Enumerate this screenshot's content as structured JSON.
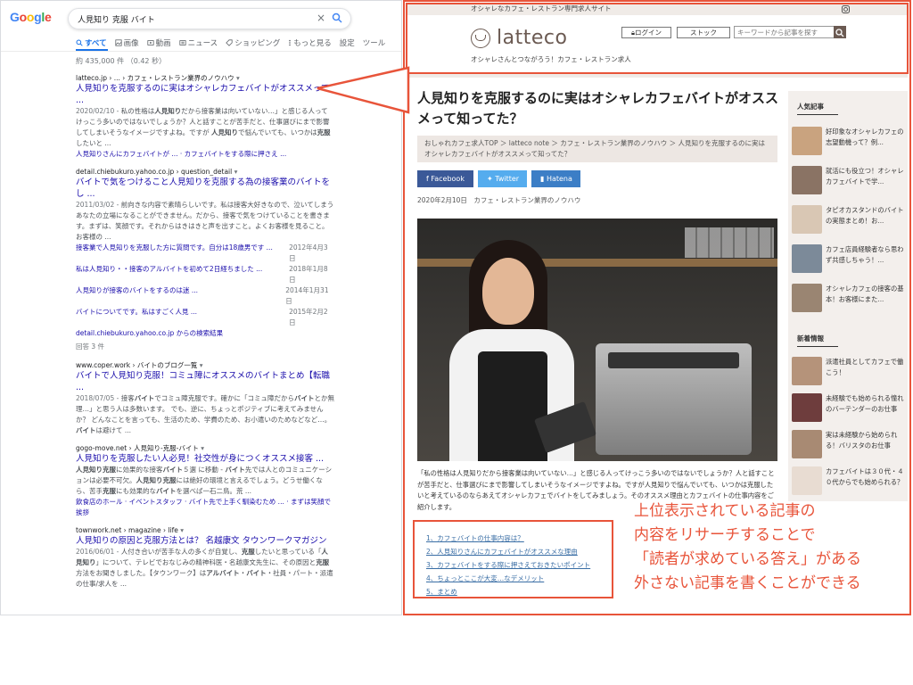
{
  "colors": {
    "accent": "#e8543a",
    "google_link": "#1a0dab",
    "google_blue": "#1a73e8",
    "latteco_brown": "#6b5a52"
  },
  "google": {
    "logo": "Google",
    "logo_letters": [
      {
        "ch": "G",
        "color": "#4285f4"
      },
      {
        "ch": "o",
        "color": "#ea4335"
      },
      {
        "ch": "o",
        "color": "#fbbc05"
      },
      {
        "ch": "g",
        "color": "#4285f4"
      },
      {
        "ch": "l",
        "color": "#34a853"
      },
      {
        "ch": "e",
        "color": "#ea4335"
      }
    ],
    "query": "人見知り 克服 バイト",
    "clear_icon": "×",
    "tabs": [
      "すべて",
      "画像",
      "動画",
      "ニュース",
      "ショッピング",
      "もっと見る",
      "設定",
      "ツール"
    ],
    "stats": "約 435,000 件 （0.42 秒）",
    "results": [
      {
        "cite": "latteco.jp › ... › カフェ・レストラン業界のノウハウ",
        "title": "人見知りを克服するのに実はオシャレカフェバイトがオススメって ...",
        "snippet": [
          {
            "t": "2020/02/10 - ",
            "c": "date"
          },
          {
            "t": "私の性格は"
          },
          {
            "t": "人見知り",
            "c": "b"
          },
          {
            "t": "だから接客業は向いていない…」と感じる人ってけっこう多いのではないでしょうか？人と話すことが苦手だと、仕事選びにまで影響してしまいそうなイメージですよね。ですが "
          },
          {
            "t": "人見知り",
            "c": "b"
          },
          {
            "t": "で悩んでいても、いつかは"
          },
          {
            "t": "克服",
            "c": "b"
          },
          {
            "t": "したいと ..."
          }
        ],
        "sitelinks": "人見知りさんにカフェバイトが ... · カフェバイトをする際に押さえ ..."
      },
      {
        "cite": "detail.chiebukuro.yahoo.co.jp › question_detail",
        "title": "バイトで気をつけること人見知りを克服する為の接客業のバイトをし ...",
        "snippet": [
          {
            "t": "2011/03/02 - ",
            "c": "date"
          },
          {
            "t": "前向きな内容で素晴らしいです。私は接客大好きなので、泣いてしまうあなたの立場になることができません。だから、接客で気をつけていることを書きます。まずは、笑顔です。それからはきはきと声を出すこと。よくお客様を見ること。お客様の ..."
          }
        ],
        "qa": [
          {
            "q": "接客業で人見知りを克服した方に質問です。自分は18歳男です ...",
            "d": "2012年4月3日"
          },
          {
            "q": "私は人見知り・・接客のアルバイトを初めて2日経ちました ...",
            "d": "2018年1月8日"
          },
          {
            "q": "人見知りが接客のバイトをするのは迷 ...",
            "d": "2014年1月31日"
          },
          {
            "q": "バイトについてです。私はすごく人見 ...",
            "d": "2015年2月2日"
          }
        ],
        "more": "detail.chiebukuro.yahoo.co.jp からの検索結果",
        "answers": "回答 3 件"
      },
      {
        "cite": "www.coper.work › バイトのブログ一覧",
        "title": "バイトで人見知り克服！コミュ障にオススメのバイトまとめ【転職 ...",
        "snippet": [
          {
            "t": "2018/07/05 - ",
            "c": "date"
          },
          {
            "t": "接客"
          },
          {
            "t": "バイト",
            "c": "b"
          },
          {
            "t": "でコミュ障克服です。確かに「コミュ障だから"
          },
          {
            "t": "バイト",
            "c": "b"
          },
          {
            "t": "とか無理…」と思う人は多数います。 でも、逆に、ちょっとポジティブに考えてみませんか？ どんなことを言っても、生活のため、学費のため、お小遣いのためなどなど…。"
          },
          {
            "t": "バイト",
            "c": "b"
          },
          {
            "t": "は避けて ..."
          }
        ]
      },
      {
        "cite": "gogo-move.net › 人見知り-克服-バイト",
        "title": "人見知りを克服したい人必見！社交性が身につくオススメ接客 ...",
        "snippet": [
          {
            "t": "人見知り",
            "c": "b"
          },
          {
            "t": "克服",
            "c": "b"
          },
          {
            "t": "に効果的な接客"
          },
          {
            "t": "バイト",
            "c": "b"
          },
          {
            "t": "５選 に移動 - "
          },
          {
            "t": "バイト",
            "c": "b"
          },
          {
            "t": "先では人とのコミュニケーションは必要不可欠。"
          },
          {
            "t": "人見知り",
            "c": "b"
          },
          {
            "t": "克服",
            "c": "b"
          },
          {
            "t": "には絶好の環境と言えるでしょう。どうせ働くなら、苦手"
          },
          {
            "t": "克服",
            "c": "b"
          },
          {
            "t": "にも効果的な"
          },
          {
            "t": "バイト",
            "c": "b"
          },
          {
            "t": "を選べば一石二鳥。荒 ..."
          }
        ],
        "sitelinks": "飲食店のホール · イベントスタッフ · バイト先で上手く馴染むため ... · まずは笑顔で挨拶"
      },
      {
        "cite": "townwork.net › magazine › life",
        "title": "人見知りの原因と克服方法とは？ 名越康文 タウンワークマガジン",
        "snippet": [
          {
            "t": "2016/06/01 - ",
            "c": "date"
          },
          {
            "t": "人付き合いが苦手な人の多くが自覚し、"
          },
          {
            "t": "克服",
            "c": "b"
          },
          {
            "t": "したいと思っている「"
          },
          {
            "t": "人見知り",
            "c": "b"
          },
          {
            "t": "」について、テレビでおなじみの精神科医・名越康文先生に、その原因と"
          },
          {
            "t": "克服",
            "c": "b"
          },
          {
            "t": "方法をお聞きしました。【タウンワーク】は"
          },
          {
            "t": "アルバイト",
            "c": "b"
          },
          {
            "t": "・"
          },
          {
            "t": "バイト",
            "c": "b"
          },
          {
            "t": "・社員・パート・派遣の仕事/求人を ..."
          }
        ]
      }
    ]
  },
  "latteco": {
    "topbar_text": "オシャレなカフェ・レストラン専門求人サイト",
    "logo_text": "latteco",
    "tagline": "オシャレさんとつながろう！カフェ・レストラン求人",
    "login_label": "ログイン",
    "stock_label": "ストック",
    "search_placeholder": "キーワードから記事を探す",
    "article_title": "人見知りを克服するのに実はオシャレカフェバイトがオススメって知ってた？",
    "breadcrumb": "おしゃれカフェ求人TOP ＞ latteco note ＞ カフェ・レストラン業界のノウハウ ＞ 人見知りを克服するのに実はオシャレカフェバイトがオススメって知ってた？",
    "share": {
      "facebook": "Facebook",
      "twitter": "Twitter",
      "hatena": "Hatena"
    },
    "date": "2020年2月10日　カフェ・レストラン業界のノウハウ",
    "body_text": "「私の性格は人見知りだから接客業は向いていない…」と感じる人ってけっこう多いのではないでしょうか？人と話すことが苦手だと、仕事選びにまで影響してしまいそうなイメージですよね。ですが人見知りで悩んでいても、いつかは克服したいと考えているのならあえてオシャレカフェでバイトをしてみましょう。そのオススメ理由とカフェバイトの仕事内容をご紹介します。",
    "toc": [
      "1、カフェバイトの仕事内容は？",
      "2、人見知りさんにカフェバイトがオススメな理由",
      "3、カフェバイトをする際に押さえておきたいポイント",
      "4、ちょっとここが大変…なデメリット",
      "5、まとめ"
    ],
    "sidebar": {
      "popular_heading": "人気記事",
      "popular": [
        {
          "text": "好印象なオシャレカフェの志望動機って？例...",
          "color": "#c9a37f"
        },
        {
          "text": "就活にも役立つ！オシャレカフェバイトで学...",
          "color": "#8a7364"
        },
        {
          "text": "タピオカスタンドのバイトの実態まとめ！お...",
          "color": "#d9c7b4"
        },
        {
          "text": "カフェ店員経験者なら思わず共感しちゃう！...",
          "color": "#7c8a99"
        },
        {
          "text": "オシャレカフェの接客の基本！お客様にまた...",
          "color": "#9a8572"
        }
      ],
      "new_heading": "新着情報",
      "new": [
        {
          "text": "派遣社員としてカフェで働こう！",
          "color": "#b5937a"
        },
        {
          "text": "未経験でも始められる憧れのバーテンダーのお仕事",
          "color": "#6e3d3d"
        },
        {
          "text": "実は未経験から始められる！バリスタのお仕事",
          "color": "#a88a73"
        },
        {
          "text": "カフェバイトは３０代・４０代からでも始められる？",
          "color": "#e8dcd2"
        }
      ]
    }
  },
  "callout": {
    "lines": [
      "上位表示されている記事の",
      "内容をリサーチすることで",
      "「読者が求めている答え」がある",
      "外さない記事を書くことができる"
    ]
  }
}
